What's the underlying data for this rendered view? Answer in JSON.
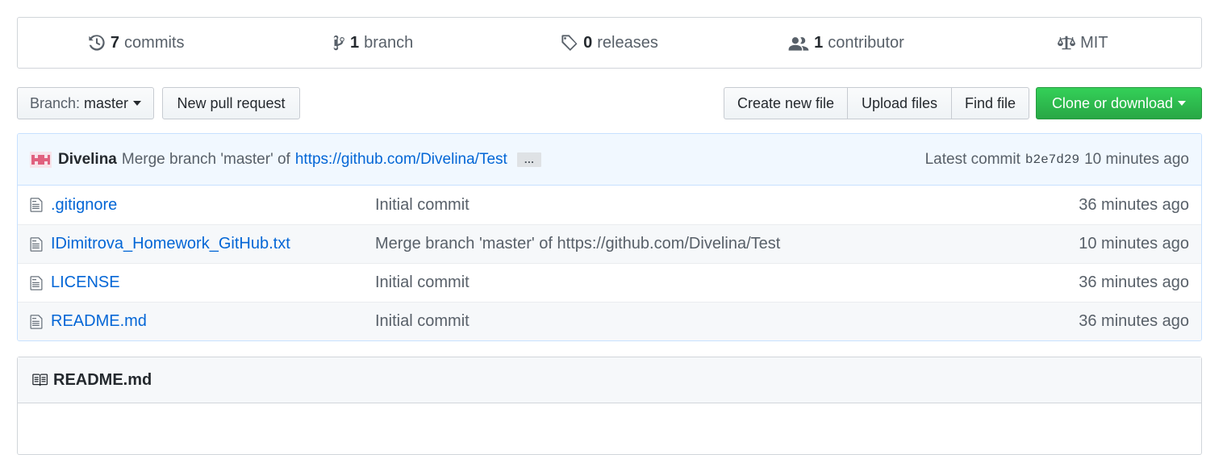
{
  "summary": {
    "commits": {
      "num": "7",
      "label": "commits"
    },
    "branches": {
      "num": "1",
      "label": "branch"
    },
    "releases": {
      "num": "0",
      "label": "releases"
    },
    "contributors": {
      "num": "1",
      "label": "contributor"
    },
    "license": "MIT"
  },
  "toolbar": {
    "branch_prefix": "Branch:",
    "branch_name": "master",
    "new_pr": "New pull request",
    "create_file": "Create new file",
    "upload_files": "Upload files",
    "find_file": "Find file",
    "clone": "Clone or download"
  },
  "commit": {
    "author": "Divelina",
    "message": "Merge branch 'master' of",
    "link": "https://github.com/Divelina/Test",
    "ellipsis": "…",
    "latest_label": "Latest commit",
    "sha": "b2e7d29",
    "age": "10 minutes ago"
  },
  "files": [
    {
      "name": ".gitignore",
      "message": "Initial commit",
      "age": "36 minutes ago"
    },
    {
      "name": "IDimitrova_Homework_GitHub.txt",
      "message": "Merge branch 'master' of https://github.com/Divelina/Test",
      "age": "10 minutes ago"
    },
    {
      "name": "LICENSE",
      "message": "Initial commit",
      "age": "36 minutes ago"
    },
    {
      "name": "README.md",
      "message": "Initial commit",
      "age": "36 minutes ago"
    }
  ],
  "readme": {
    "title": "README.md"
  },
  "colors": {
    "link": "#0366d6",
    "clone_green": "#28a745",
    "commit_bg": "#f1f8ff"
  }
}
